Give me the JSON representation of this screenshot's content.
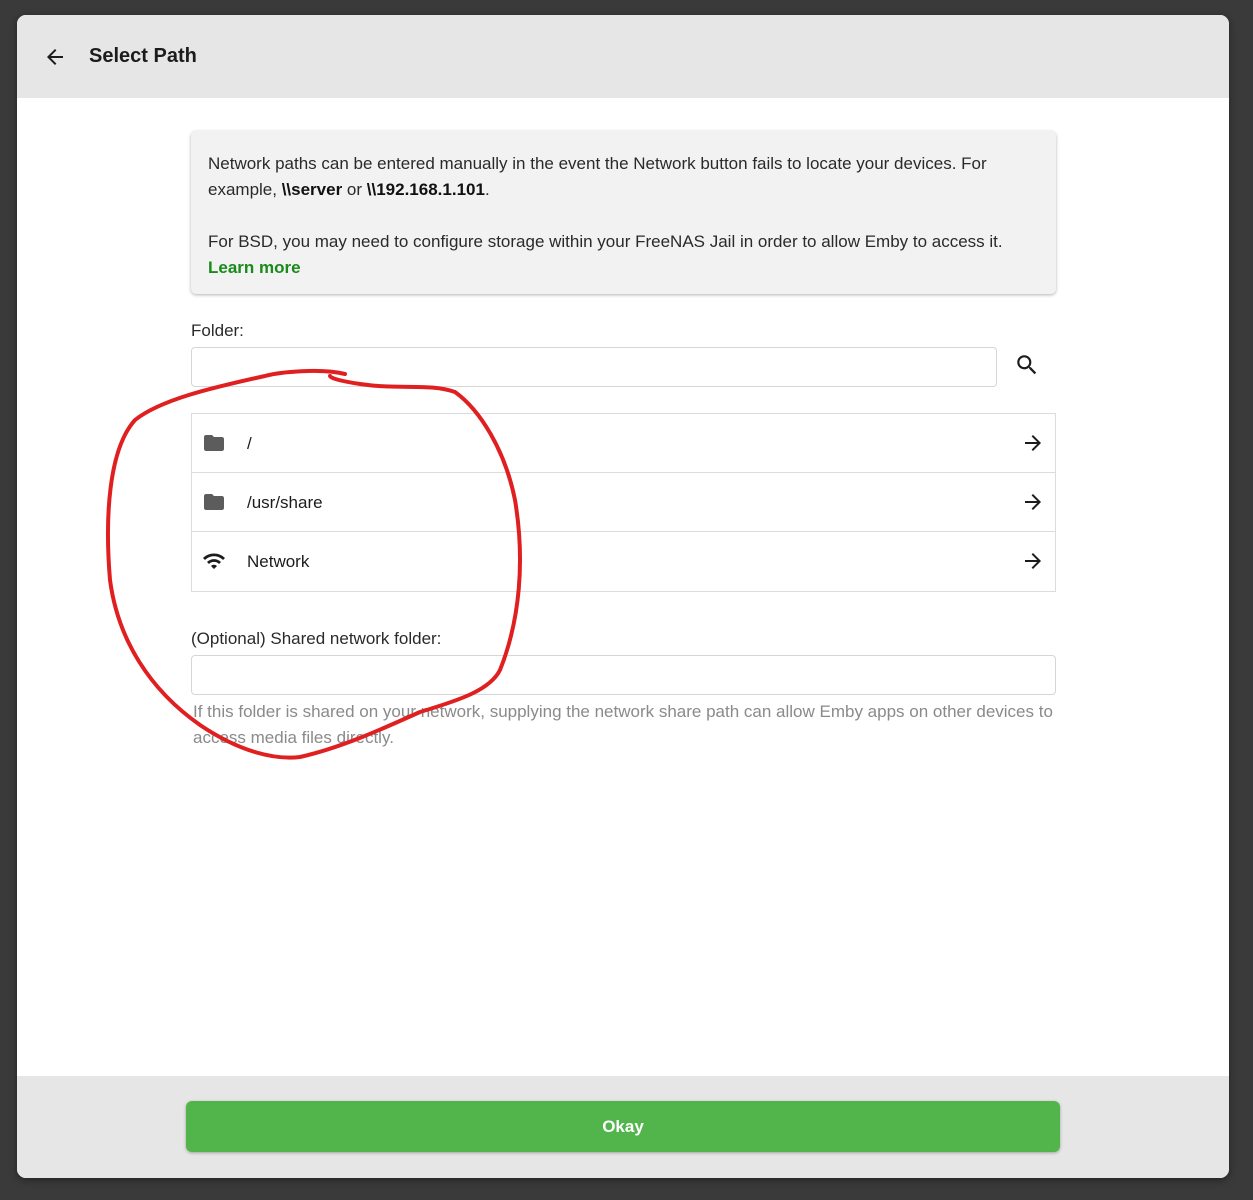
{
  "header": {
    "title": "Select Path"
  },
  "info": {
    "line1_prefix": "Network paths can be entered manually in the event the Network button fails to locate your devices. For example, ",
    "example1": "\\\\server",
    "or_text": " or ",
    "example2": "\\\\192.168.1.101",
    "line1_suffix": ".",
    "line2": "For BSD, you may need to configure storage within your FreeNAS Jail in order to allow Emby to access it.",
    "learn_more": "Learn more"
  },
  "folder": {
    "label": "Folder:",
    "value": "",
    "placeholder": ""
  },
  "directories": [
    {
      "label": "/",
      "icon": "folder-icon"
    },
    {
      "label": "/usr/share",
      "icon": "folder-icon"
    },
    {
      "label": "Network",
      "icon": "wifi-icon"
    }
  ],
  "shared_folder": {
    "label": "(Optional) Shared network folder:",
    "value": "",
    "placeholder": "",
    "helper": "If this folder is shared on your network, supplying the network share path can allow Emby apps on other devices to access media files directly."
  },
  "footer": {
    "okay_label": "Okay"
  },
  "colors": {
    "accent": "#52b54b",
    "link": "#1a8a1a",
    "annotation": "#e02020"
  }
}
